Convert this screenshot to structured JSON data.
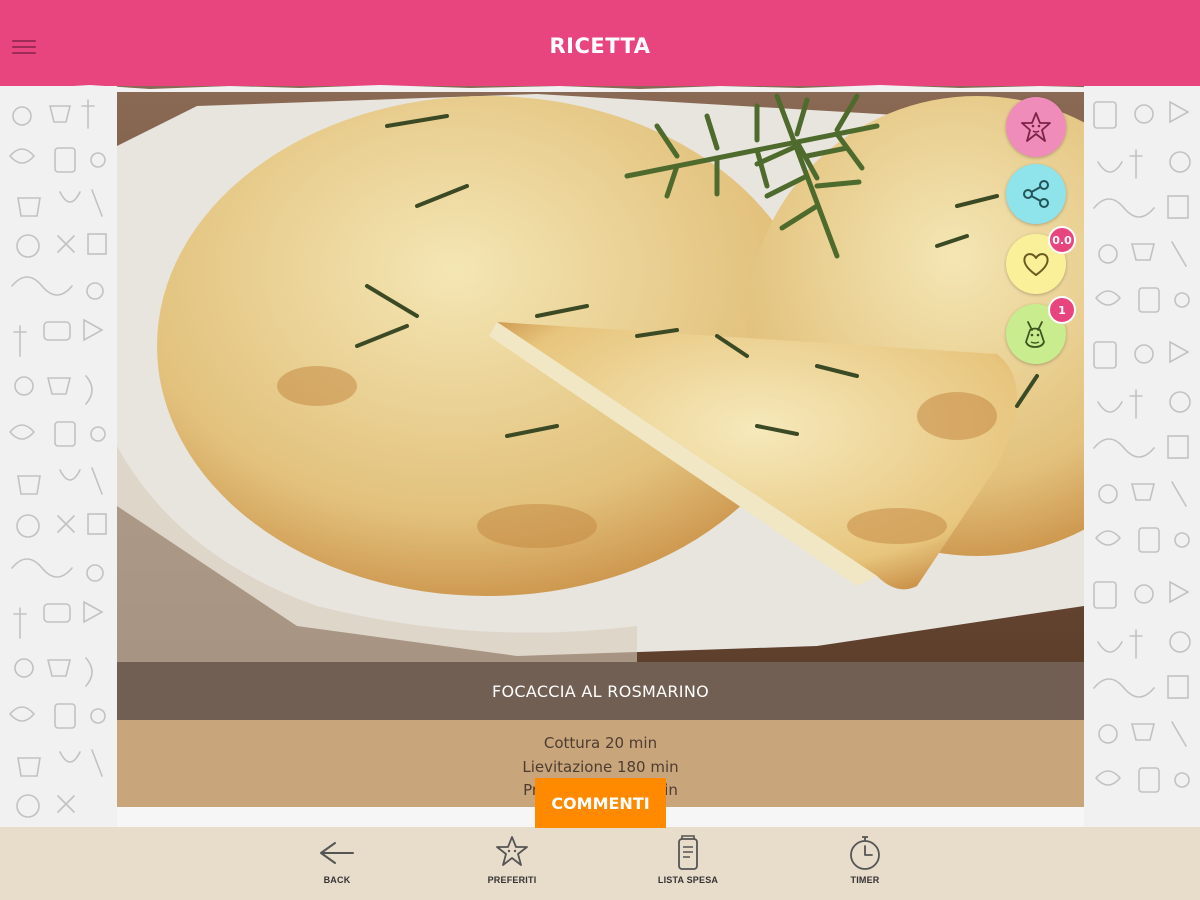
{
  "header": {
    "title": "RICETTA",
    "menu_icon": "hamburger-menu-icon",
    "background_color": "#e8457e"
  },
  "recipe": {
    "name": "FOCACCIA AL ROSMARINO",
    "details": [
      "Cottura 20 min",
      "Lievitazione 180 min",
      "Preparazione 20 min"
    ]
  },
  "actions": [
    {
      "name": "favorite-star-button",
      "icon": "star-doodle-icon",
      "color": "#f08cba"
    },
    {
      "name": "share-button",
      "icon": "share-icon",
      "color": "#8fe3ea"
    },
    {
      "name": "like-button",
      "icon": "heart-icon",
      "color": "#faf09a",
      "badge": "0.0"
    },
    {
      "name": "difficulty-button",
      "icon": "donkey-icon",
      "color": "#c9ec8e",
      "badge": "1"
    }
  ],
  "comments_button": "COMMENTI",
  "bottom_nav": [
    {
      "label": "BACK",
      "icon": "back-arrow-icon"
    },
    {
      "label": "PREFERITI",
      "icon": "star-doodle-icon"
    },
    {
      "label": "LISTA SPESA",
      "icon": "shopping-list-jar-icon"
    },
    {
      "label": "TIMER",
      "icon": "stopwatch-icon"
    }
  ],
  "colors": {
    "accent_pink": "#e8457e",
    "orange": "#ff8a00",
    "brown_bar": "#715f54",
    "tan_info": "#c9a57c",
    "bottom_bar": "#e8dccb"
  }
}
